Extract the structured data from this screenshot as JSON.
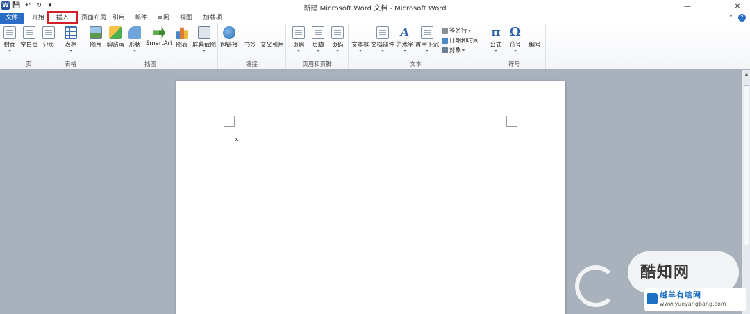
{
  "window": {
    "title": "新建 Microsoft Word 文档 - Microsoft Word",
    "controls": {
      "minimize": "—",
      "restore": "❐",
      "close": "✕"
    }
  },
  "qat": {
    "logo": "W",
    "save": "💾",
    "undo": "↶",
    "redo": "↻",
    "customize": "▾"
  },
  "tabs": {
    "file": "文件",
    "home": "开始",
    "insert": "插入",
    "layout": "页面布局",
    "references": "引用",
    "mailings": "邮件",
    "review": "审阅",
    "view": "视图",
    "addins": "加载项",
    "active": "插入"
  },
  "help": {
    "collapse": "⌃",
    "q": "?"
  },
  "ribbon": {
    "pages": {
      "name": "页",
      "cover": "封面",
      "blank": "空白页",
      "break": "分页"
    },
    "tables": {
      "name": "表格",
      "table": "表格"
    },
    "illustrations": {
      "name": "插图",
      "picture": "图片",
      "clipart": "剪贴画",
      "shapes": "形状",
      "smartart": "SmartArt",
      "chart": "图表",
      "screenshot": "屏幕截图"
    },
    "links": {
      "name": "链接",
      "hyperlink": "超链接",
      "bookmark": "书签",
      "crossref": "交叉引用"
    },
    "headerfooter": {
      "name": "页眉和页脚",
      "header": "页眉",
      "footer": "页脚",
      "pagenum": "页码"
    },
    "text": {
      "name": "文本",
      "textbox": "文本框",
      "quickparts": "文档部件",
      "wordart": "艺术字",
      "dropcap": "首字下沉",
      "signature": "签名行",
      "datetime": "日期和时间",
      "object": "对象"
    },
    "symbols": {
      "name": "符号",
      "equation": "公式",
      "symbol": "符号",
      "number": "编号",
      "pi": "π",
      "omega": "Ω"
    }
  },
  "document": {
    "text": "x"
  },
  "watermark": {
    "brand": "酷知网",
    "site_name": "越羊有啥网",
    "site_url": "www.yueyangbang.com"
  },
  "colors": {
    "accent": "#2b6cc4",
    "highlight": "#d0202a",
    "ribbon_bg": "#f3f5f8",
    "doc_bg": "#a9b1bc"
  }
}
